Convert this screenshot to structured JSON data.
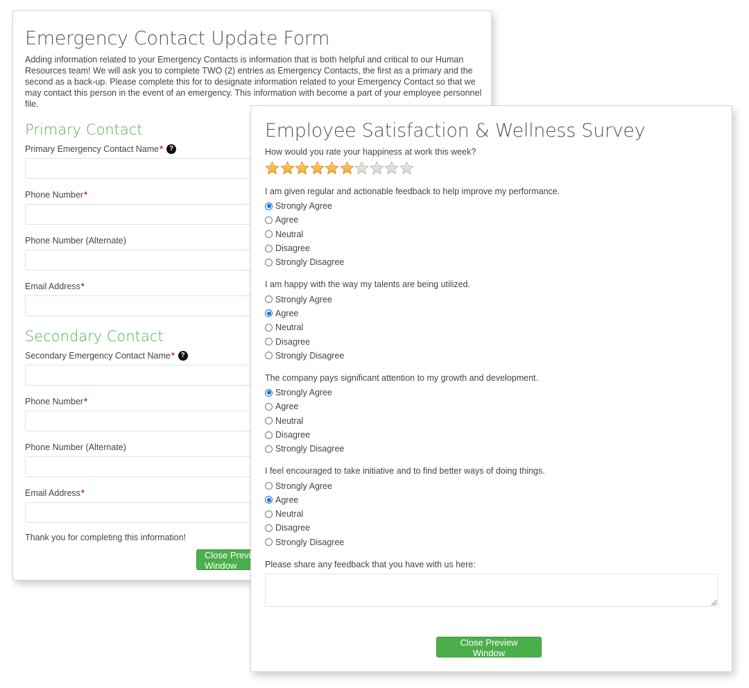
{
  "emergency_form": {
    "title": "Emergency Contact Update Form",
    "intro": "Adding information related to your Emergency Contacts is information that is both helpful and critical to our Human Resources team! We will ask you to complete TWO (2) entries as Emergency Contacts, the first as a primary and the second as a back-up. Please complete this for to designate information related to your Emergency Contact so that we may contact this person in the event of an emergency. This information with become a part of your employee personnel file.",
    "required_marker": "*",
    "help_glyph": "?",
    "primary": {
      "heading": "Primary Contact",
      "fields": [
        {
          "label": "Primary Emergency Contact Name",
          "required": true,
          "help": true,
          "value": ""
        },
        {
          "label": "Phone Number",
          "required": true,
          "help": false,
          "value": ""
        },
        {
          "label": "Phone Number (Alternate)",
          "required": false,
          "help": false,
          "value": ""
        },
        {
          "label": "Email Address",
          "required": true,
          "help": false,
          "value": ""
        }
      ]
    },
    "secondary": {
      "heading": "Secondary Contact",
      "fields": [
        {
          "label": "Secondary Emergency Contact Name",
          "required": true,
          "help": true,
          "value": ""
        },
        {
          "label": "Phone Number",
          "required": true,
          "help": false,
          "value": ""
        },
        {
          "label": "Phone Number (Alternate)",
          "required": false,
          "help": false,
          "value": ""
        },
        {
          "label": "Email Address",
          "required": true,
          "help": false,
          "value": ""
        }
      ]
    },
    "thanks": "Thank you for completing this information!",
    "close_button": "Close Preview Window"
  },
  "survey": {
    "title": "Employee Satisfaction & Wellness Survey",
    "rating": {
      "label": "How would you rate your happiness at work this week?",
      "value": 6,
      "max": 10
    },
    "options": [
      "Strongly Agree",
      "Agree",
      "Neutral",
      "Disagree",
      "Strongly Disagree"
    ],
    "questions": [
      {
        "text": "I am given regular and actionable feedback to help improve my performance.",
        "selected": "Strongly Agree"
      },
      {
        "text": "I am happy with the way my talents are being utilized.",
        "selected": "Agree"
      },
      {
        "text": "The company pays significant attention to my growth and development.",
        "selected": "Strongly Agree"
      },
      {
        "text": "I feel encouraged to take initiative and to find better ways of doing things.",
        "selected": "Agree"
      }
    ],
    "feedback": {
      "label": "Please share any feedback that you have with us here:",
      "value": ""
    },
    "close_button": "Close Preview Window"
  },
  "colors": {
    "accent_green": "#4cae4c",
    "required_red": "#c9302c",
    "radio_blue": "#1a73e8",
    "star_filled": "#f5a623",
    "star_empty": "#d6d6d6"
  }
}
